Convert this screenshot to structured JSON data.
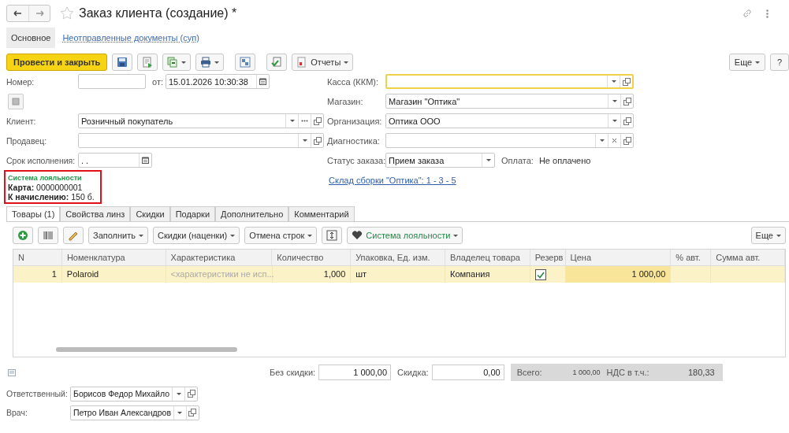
{
  "window": {
    "title": "Заказ клиента (создание) *"
  },
  "sections": [
    {
      "label": "Основное",
      "selected": true
    },
    {
      "label": "Неотправленные документы (суп)",
      "selected": false
    }
  ],
  "toolbar": {
    "primary": "Провести и закрыть",
    "items": [
      {
        "kind": "save"
      },
      {
        "kind": "post"
      },
      {
        "kind": "create-based",
        "menu": true
      },
      {
        "kind": "print",
        "menu": true
      },
      {
        "kind": "structure"
      },
      {
        "kind": "check"
      },
      {
        "kind": "reports",
        "label": "Отчеты",
        "menu": true
      }
    ],
    "more": "Еще",
    "help": "?"
  },
  "number": {
    "label": "Номер:"
  },
  "date": {
    "label": "от:",
    "value": "15.01.2026 10:30:38"
  },
  "left_fields": [
    {
      "label": "Клиент:",
      "value": "Розничный покупатель",
      "kind": "reference"
    },
    {
      "label": "Продавец:",
      "kind": "select"
    },
    {
      "label": "Срок исполнения:",
      "value": ". .",
      "kind": "date"
    }
  ],
  "loyalty": {
    "title": "Система лояльности",
    "lines": [
      "**Карта:** 0000000001",
      "**К начислению:** 150 б."
    ]
  },
  "right_fields": [
    {
      "label": "Касса (ККМ):",
      "focused": true,
      "kind": "select"
    },
    {
      "label": "Магазин:",
      "value": "Магазин \"Оптика\"",
      "focused": false,
      "kind": "select"
    },
    {
      "label": "Организация:",
      "value": "Оптика ООО",
      "focused": false,
      "kind": "select"
    },
    {
      "label": "Диагностика:",
      "focused": false,
      "kind": "clearable"
    }
  ],
  "status": {
    "label": "Статус заказа:",
    "value": "Прием заказа"
  },
  "payment": {
    "label": "Оплата:",
    "value": "Не оплачено"
  },
  "warehouse_link": "Склад сборки \"Оптика\": 1 - 3 - 5",
  "tabs": [
    {
      "label": "Товары (1)",
      "selected": true
    },
    {
      "label": "Свойства линз",
      "selected": false
    },
    {
      "label": "Скидки",
      "selected": false
    },
    {
      "label": "Подарки",
      "selected": false
    },
    {
      "label": "Дополнительно",
      "selected": false
    },
    {
      "label": "Комментарий",
      "selected": false
    }
  ],
  "table_toolbar": {
    "items": [
      {
        "kind": "add"
      },
      {
        "kind": "barcode"
      },
      {
        "kind": "pick"
      },
      {
        "kind": "menu",
        "label": "Заполнить"
      },
      {
        "kind": "menu",
        "label": "Скидки (наценки)"
      },
      {
        "kind": "menu",
        "label": "Отмена строк"
      },
      {
        "kind": "split"
      },
      {
        "kind": "loyalty",
        "label": "Система лояльности"
      }
    ],
    "more": "Еще"
  },
  "table": {
    "columns": [
      "N",
      "Номенклатура",
      "Характеристика",
      "Количество",
      "Упаковка, Ед. изм.",
      "Владелец товара",
      "Резерв",
      "Цена",
      "% авт.",
      "Сумма авт."
    ],
    "rows": [
      {
        "selected": true,
        "n": "1",
        "item": "Polaroid",
        "characteristic_placeholder": "<характеристики не исп...",
        "quantity": "1,000",
        "unit": "шт",
        "owner": "Компания",
        "reserved": true,
        "price": "1 000,00"
      }
    ]
  },
  "totals": {
    "without_discount": {
      "label": "Без скидки:",
      "value": "1 000,00"
    },
    "discount": {
      "label": "Скидка:",
      "value": "0,00"
    },
    "total": {
      "label": "Всего:",
      "value": "1 000,00"
    },
    "vat": {
      "label": "НДС в т.ч.:",
      "value": "180,33"
    }
  },
  "bottom_fields": [
    {
      "label": "Ответственный:",
      "value": "Борисов Федор Михайло"
    },
    {
      "label": "Врач:",
      "value": "Петро Иван Александров"
    }
  ]
}
